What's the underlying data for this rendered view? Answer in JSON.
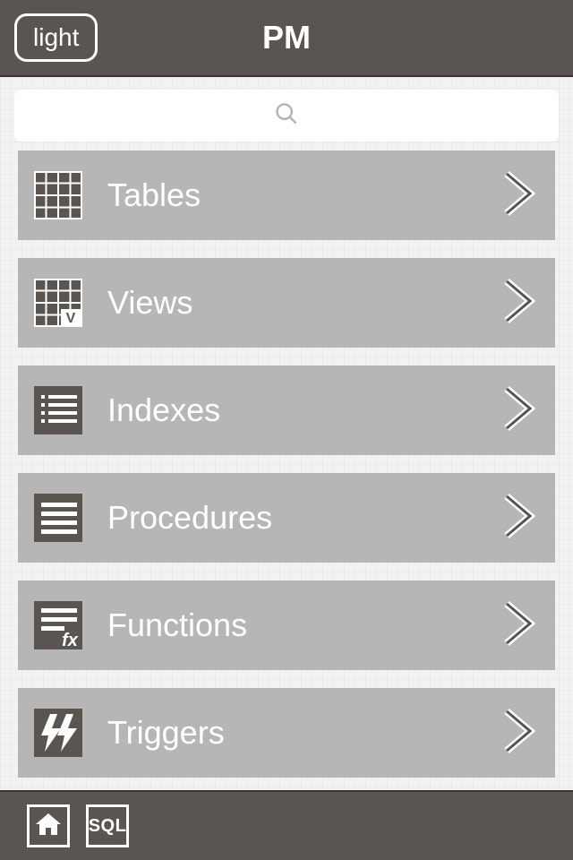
{
  "header": {
    "theme_button": "light",
    "title": "PM"
  },
  "search": {
    "placeholder": ""
  },
  "menu": [
    {
      "key": "tables",
      "label": "Tables",
      "icon": "grid-icon"
    },
    {
      "key": "views",
      "label": "Views",
      "icon": "grid-v-icon"
    },
    {
      "key": "indexes",
      "label": "Indexes",
      "icon": "list-bullets-icon"
    },
    {
      "key": "procedures",
      "label": "Procedures",
      "icon": "lines-icon"
    },
    {
      "key": "functions",
      "label": "Functions",
      "icon": "fx-icon"
    },
    {
      "key": "triggers",
      "label": "Triggers",
      "icon": "lightning-icon"
    }
  ],
  "footer": {
    "sql_label": "SQL"
  }
}
